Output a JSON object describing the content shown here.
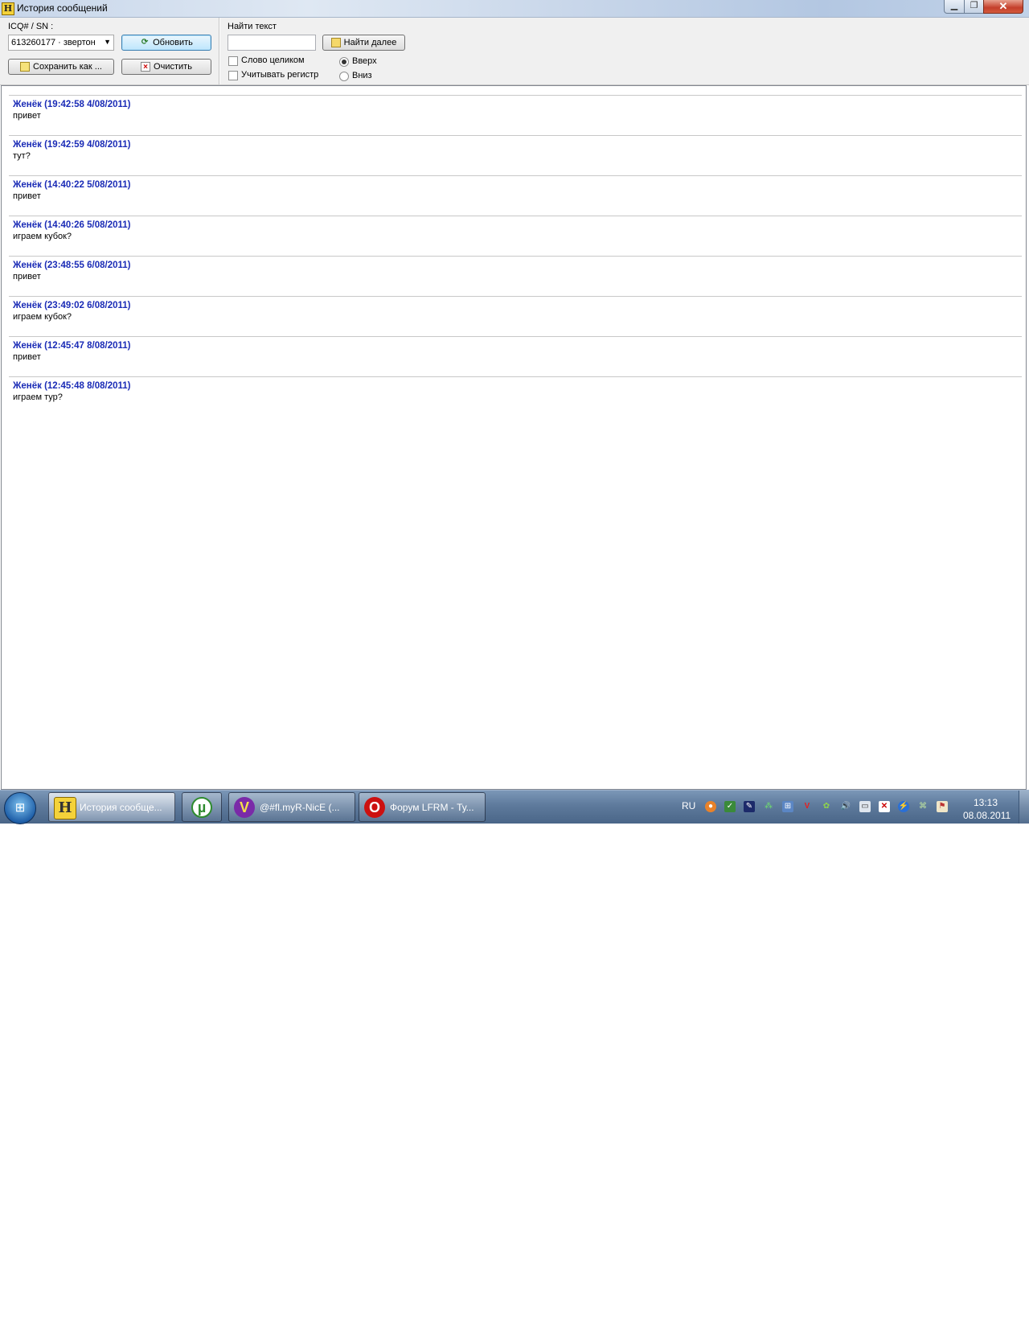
{
  "window": {
    "title": "История сообщений",
    "icon_letter": "H",
    "minimize": "▁",
    "maximize": "❐",
    "close": "✕"
  },
  "toolbar": {
    "contact_label": "ICQ# / SN :",
    "contact_value": "613260177 · звертон",
    "refresh_label": "Обновить",
    "save_label": "Сохранить как ...",
    "clear_label": "Очистить",
    "find_label": "Найти текст",
    "find_value": "",
    "find_next_label": "Найти далее",
    "whole_word_label": "Слово целиком",
    "whole_word_checked": false,
    "match_case_label": "Учитывать регистр",
    "match_case_checked": false,
    "direction_up_label": "Вверх",
    "direction_down_label": "Вниз",
    "direction_selected": "up"
  },
  "messages": [
    {
      "header": "Женёк (19:42:58 4/08/2011)",
      "text": "привет"
    },
    {
      "header": "Женёк (19:42:59 4/08/2011)",
      "text": "тут?"
    },
    {
      "header": "Женёк (14:40:22 5/08/2011)",
      "text": "привет"
    },
    {
      "header": "Женёк (14:40:26 5/08/2011)",
      "text": "играем кубок?"
    },
    {
      "header": "Женёк (23:48:55 6/08/2011)",
      "text": "привет"
    },
    {
      "header": "Женёк (23:49:02 6/08/2011)",
      "text": "играем кубок?"
    },
    {
      "header": "Женёк (12:45:47 8/08/2011)",
      "text": "привет"
    },
    {
      "header": "Женёк (12:45:48 8/08/2011)",
      "text": "играем тур?"
    }
  ],
  "taskbar": {
    "tasks": [
      {
        "label": "История сообще...",
        "icon": "H"
      },
      {
        "label": "",
        "icon": "µ"
      },
      {
        "label": "@#fl.myR-NicE (...",
        "icon": "V"
      },
      {
        "label": "Форум LFRM - Ту...",
        "icon": "O"
      }
    ],
    "language": "RU",
    "clock_time": "13:13",
    "clock_date": "08.08.2011"
  },
  "colors": {
    "message_header": "#1a2bb6",
    "utorrent": "#2e8b2e",
    "vent": "#7a2aa8",
    "opera": "#cc1010"
  }
}
